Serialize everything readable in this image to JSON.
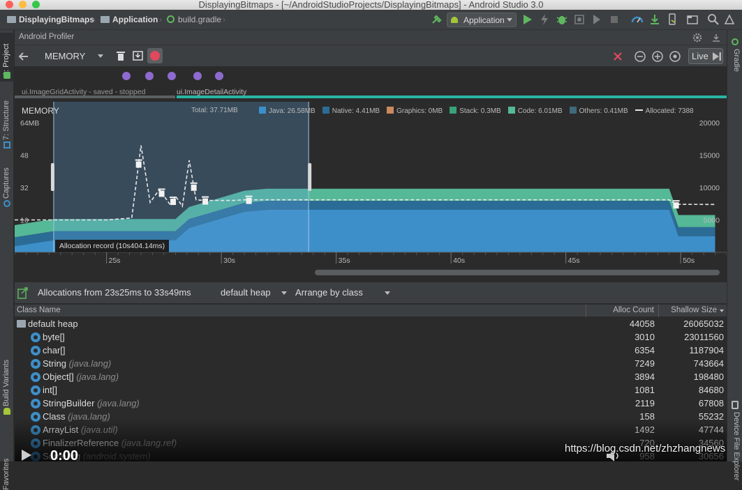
{
  "window": {
    "title": "DisplayingBitmaps - [~/AndroidStudioProjects/DisplayingBitmaps] - Android Studio 3.0"
  },
  "breadcrumbs": [
    "DisplayingBitmaps",
    "Application",
    "build.gradle"
  ],
  "run_config": "Application",
  "left_tools": [
    "1: Project",
    "7: Structure",
    "Captures",
    "Build Variants",
    "Favorites"
  ],
  "right_tools": [
    "Gradle",
    "Device File Explorer"
  ],
  "profiler": {
    "header": "Android Profiler",
    "monitor": "MEMORY",
    "live_label": "Live"
  },
  "activities": [
    {
      "label": "ui.ImageGridActivity - saved - stopped"
    },
    {
      "label": "ui.ImageDetailActivity"
    }
  ],
  "chart": {
    "title": "MEMORY",
    "total": "Total: 37.71MB",
    "legend": [
      {
        "label": "Java: 26.58MB",
        "color": "#3d8fc9"
      },
      {
        "label": "Native:  4.41MB",
        "color": "#2b6c96"
      },
      {
        "label": "Graphics: 0MB",
        "color": "#c98a5e"
      },
      {
        "label": "Stack:  0.3MB",
        "color": "#3aa178"
      },
      {
        "label": "Code: 6.01MB",
        "color": "#55b896"
      },
      {
        "label": "Others: 0.41MB",
        "color": "#3f6a7a"
      },
      {
        "label": "Allocated:  7388",
        "color": "#e8e8e8"
      }
    ],
    "left_axis": [
      "64MB",
      "48",
      "32",
      "16"
    ],
    "right_axis": [
      "20000",
      "15000",
      "10000",
      "5000"
    ],
    "time_ticks": [
      "25s",
      "30s",
      "35s",
      "40s",
      "45s",
      "50s"
    ],
    "selection_label": "Allocation record (10s404.14ms)"
  },
  "chart_data": {
    "type": "area",
    "title": "MEMORY",
    "x_unit": "s",
    "xlim": [
      21,
      52
    ],
    "ylim": [
      0,
      64
    ],
    "y2lim": [
      0,
      20000
    ],
    "x": [
      21,
      22.7,
      25.5,
      28,
      28.6,
      29.5,
      31,
      32,
      33.8,
      49.5,
      49.9,
      51.5
    ],
    "series": [
      {
        "name": "Java",
        "values": [
          3,
          6,
          6,
          6,
          12,
          15,
          20,
          21,
          21,
          21,
          8,
          8
        ]
      },
      {
        "name": "Native",
        "values": [
          4.41,
          4.41,
          4.41,
          4.41,
          4.41,
          4.41,
          4.41,
          4.41,
          4.41,
          4.41,
          4.41,
          4.41
        ]
      },
      {
        "name": "Code",
        "values": [
          6,
          6,
          6,
          6,
          6,
          6,
          6,
          6,
          6,
          6,
          6,
          6
        ]
      }
    ],
    "allocated": {
      "x": [
        21,
        25,
        26.1,
        26.5,
        26.9,
        27.3,
        27.8,
        28,
        28.3,
        28.6,
        28.9,
        29.3,
        30.5,
        31,
        32,
        33.8,
        49.5,
        49.8,
        51.5
      ],
      "values": [
        5000,
        5000,
        5300,
        16500,
        7700,
        9700,
        7200,
        8700,
        7100,
        14200,
        8100,
        8000,
        8000,
        8100,
        8100,
        8100,
        8100,
        7400,
        7388
      ]
    }
  },
  "allocations_bar": {
    "label": "Allocations from 23s25ms to 33s49ms",
    "heap": "default heap",
    "arrange": "Arrange by class"
  },
  "table": {
    "columns": [
      "Class Name",
      "Alloc Count",
      "Shallow Size"
    ],
    "rows": [
      {
        "name": "default heap",
        "pkg": "",
        "count": "44058",
        "size": "26065032"
      },
      {
        "name": "byte[]",
        "pkg": "",
        "count": "3010",
        "size": "23011560"
      },
      {
        "name": "char[]",
        "pkg": "",
        "count": "6354",
        "size": "1187904"
      },
      {
        "name": "String",
        "pkg": "(java.lang)",
        "count": "7249",
        "size": "743664"
      },
      {
        "name": "Object[]",
        "pkg": "(java.lang)",
        "count": "3894",
        "size": "198480"
      },
      {
        "name": "int[]",
        "pkg": "",
        "count": "1081",
        "size": "84680"
      },
      {
        "name": "StringBuilder",
        "pkg": "(java.lang)",
        "count": "2119",
        "size": "67808"
      },
      {
        "name": "Class",
        "pkg": "(java.lang)",
        "count": "158",
        "size": "55232"
      },
      {
        "name": "ArrayList",
        "pkg": "(java.util)",
        "count": "1492",
        "size": "47744"
      },
      {
        "name": "FinalizerReference",
        "pkg": "(java.lang.ref)",
        "count": "720",
        "size": "34560"
      },
      {
        "name": "SomeArg",
        "pkg": "(android.system)",
        "count": "958",
        "size": "30656"
      }
    ]
  },
  "overlay": {
    "time": "0:00",
    "watermark": "https://blog.csdn.net/zhzhangnews"
  }
}
